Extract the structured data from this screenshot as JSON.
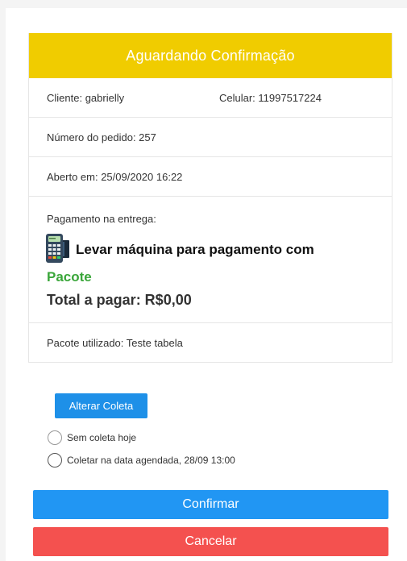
{
  "header": {
    "title": "Aguardando Confirmação"
  },
  "order": {
    "client": "Cliente: gabrielly",
    "phone": "Celular: 11997517224",
    "number": "Número do pedido: 257",
    "opened": "Aberto em: 25/09/2020 16:22"
  },
  "payment": {
    "label": "Pagamento na entrega:",
    "method": "Levar máquina para pagamento com",
    "package": "Pacote",
    "total": "Total a pagar: R$0,00"
  },
  "package_used": "Pacote utilizado: Teste tabela",
  "actions": {
    "change_pickup": "Alterar Coleta",
    "options": [
      "Sem coleta hoje",
      "Coletar na data agendada, 28/09 13:00"
    ],
    "confirm": "Confirmar",
    "cancel": "Cancelar"
  },
  "colors": {
    "header": "#f0cc00",
    "package": "#3aa63a",
    "confirm": "#2196f3",
    "cancel": "#f4514f",
    "change": "#1e90e8"
  },
  "icons": {
    "payment_method": "card-machine-icon"
  }
}
